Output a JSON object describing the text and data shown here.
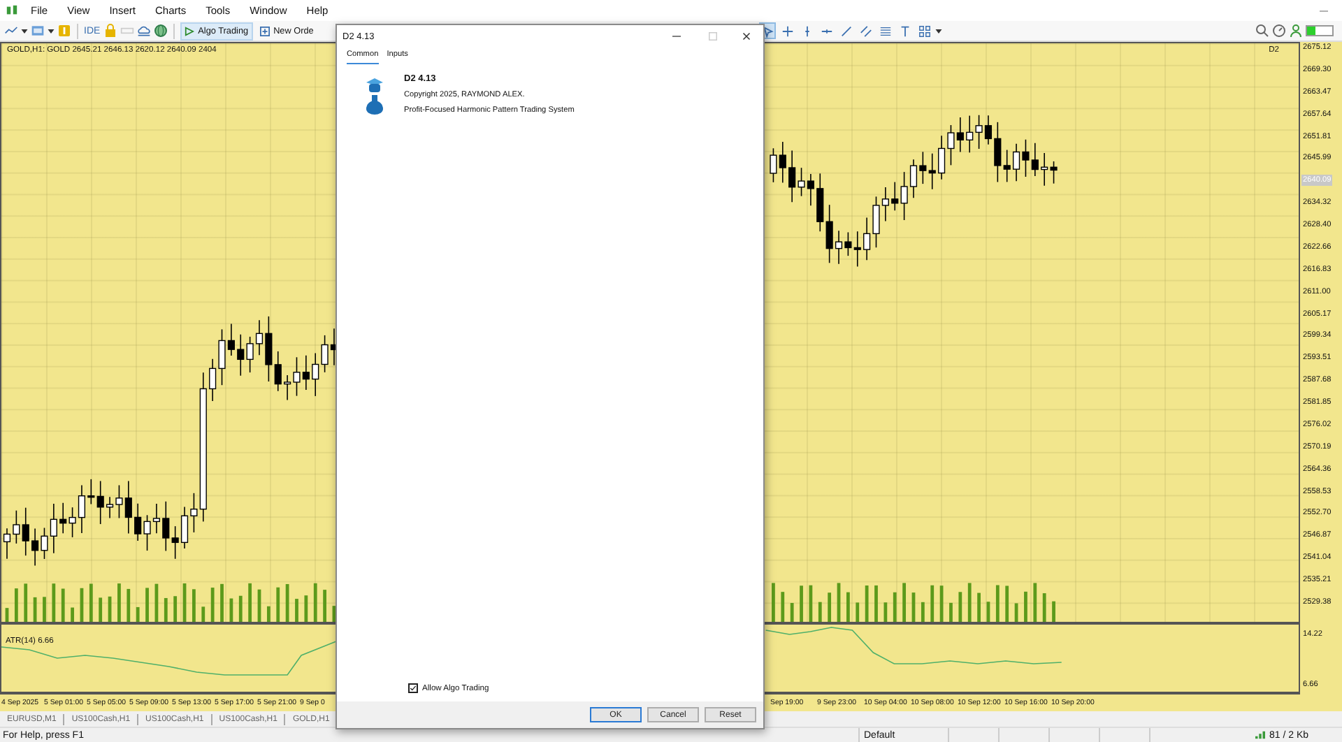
{
  "menu": [
    "File",
    "View",
    "Insert",
    "Charts",
    "Tools",
    "Window",
    "Help"
  ],
  "toolbar": {
    "ide": "IDE",
    "algo_trading": {
      "label": "Algo Trading",
      "on": true
    },
    "new_order": "New Orde"
  },
  "drawing_tools": [
    {
      "kind": "cursor",
      "selected": true
    },
    {
      "kind": "crosshair",
      "selected": false
    },
    {
      "kind": "vline",
      "selected": false
    },
    {
      "kind": "hline",
      "selected": false
    },
    {
      "kind": "trend",
      "selected": false
    },
    {
      "kind": "channel",
      "selected": false
    },
    {
      "kind": "fibo",
      "selected": false
    },
    {
      "kind": "text",
      "selected": false
    },
    {
      "kind": "shapes",
      "selected": false
    }
  ],
  "chart": {
    "header": "GOLD,H1: GOLD 2645.21 2646.13 2620.12 2640.09 2404",
    "indicator_name": "D2",
    "price_axis": [
      {
        "label": "2675.12",
        "current": false
      },
      {
        "label": "2669.30",
        "current": false
      },
      {
        "label": "2663.47",
        "current": false
      },
      {
        "label": "2657.64",
        "current": false
      },
      {
        "label": "2651.81",
        "current": false
      },
      {
        "label": "2645.99",
        "current": false
      },
      {
        "label": "2640.09",
        "current": true
      },
      {
        "label": "2634.32",
        "current": false
      },
      {
        "label": "2628.40",
        "current": false
      },
      {
        "label": "2622.66",
        "current": false
      },
      {
        "label": "2616.83",
        "current": false
      },
      {
        "label": "2611.00",
        "current": false
      },
      {
        "label": "2605.17",
        "current": false
      },
      {
        "label": "2599.34",
        "current": false
      },
      {
        "label": "2593.51",
        "current": false
      },
      {
        "label": "2587.68",
        "current": false
      },
      {
        "label": "2581.85",
        "current": false
      },
      {
        "label": "2576.02",
        "current": false
      },
      {
        "label": "2570.19",
        "current": false
      },
      {
        "label": "2564.36",
        "current": false
      },
      {
        "label": "2558.53",
        "current": false
      },
      {
        "label": "2552.70",
        "current": false
      },
      {
        "label": "2546.87",
        "current": false
      },
      {
        "label": "2541.04",
        "current": false
      },
      {
        "label": "2535.21",
        "current": false
      },
      {
        "label": "2529.38",
        "current": false
      }
    ],
    "indicator_pane": {
      "label": "ATR(14) 6.66",
      "axis": [
        "14.22",
        "6.66"
      ]
    },
    "time_axis_left": [
      "4 Sep 2025",
      "5 Sep 01:00",
      "5 Sep 05:00",
      "5 Sep 09:00",
      "5 Sep 13:00",
      "5 Sep 17:00",
      "5 Sep 21:00",
      "9 Sep 0"
    ],
    "time_axis_right": [
      "Sep 19:00",
      "9 Sep 23:00",
      "10 Sep 04:00",
      "10 Sep 08:00",
      "10 Sep 12:00",
      "10 Sep 16:00",
      "10 Sep 20:00"
    ]
  },
  "chart_tabs": [
    "EURUSD,M1",
    "US100Cash,H1",
    "US100Cash,H1",
    "US100Cash,H1",
    "GOLD,H1"
  ],
  "status_bar": {
    "help": "For Help, press F1",
    "profile": "Default",
    "traffic": "81 / 2 Kb"
  },
  "dialog": {
    "title": "D2 4.13",
    "tabs": [
      {
        "label": "Common",
        "selected": true
      },
      {
        "label": "Inputs",
        "selected": false
      }
    ],
    "name": "D2 4.13",
    "copyright": "Copyright 2025, RAYMOND ALEX.",
    "description": "Profit-Focused Harmonic Pattern Trading System",
    "allow_algo_trading": {
      "label": "Allow Algo Trading",
      "checked": true
    },
    "buttons": [
      "OK",
      "Cancel",
      "Reset"
    ]
  }
}
